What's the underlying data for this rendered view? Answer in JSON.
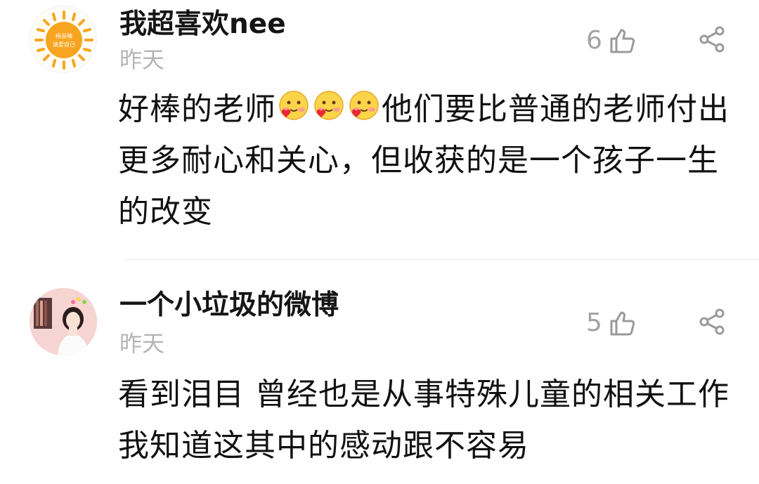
{
  "comments": [
    {
      "username": "我超喜欢nee",
      "time": "昨天",
      "likes": "6",
      "avatar": {
        "type": "sun-logo",
        "text_line1": "杨芸晴",
        "text_line2": "请爱自己",
        "color": "#f7a520"
      },
      "text_before_emoji": "好棒的老师",
      "emojis": [
        "blushing-heart-emoji",
        "blushing-heart-emoji",
        "blushing-heart-emoji"
      ],
      "text_after_emoji": "他们要比普通的老师付出更多耐心和关心，但收获的是一个孩子一生的改变"
    },
    {
      "username": "一个小垃圾的微博",
      "time": "昨天",
      "likes": "5",
      "avatar": {
        "type": "photo-girl"
      },
      "text": "看到泪目 曾经也是从事特殊儿童的相关工作 我知道这其中的感动跟不容易"
    }
  ],
  "icons": {
    "like": "thumbs-up-icon",
    "share": "share-icon"
  },
  "colors": {
    "meta_gray": "#b5b5b5",
    "icon_gray": "#9a9a9a",
    "text": "#111111"
  }
}
